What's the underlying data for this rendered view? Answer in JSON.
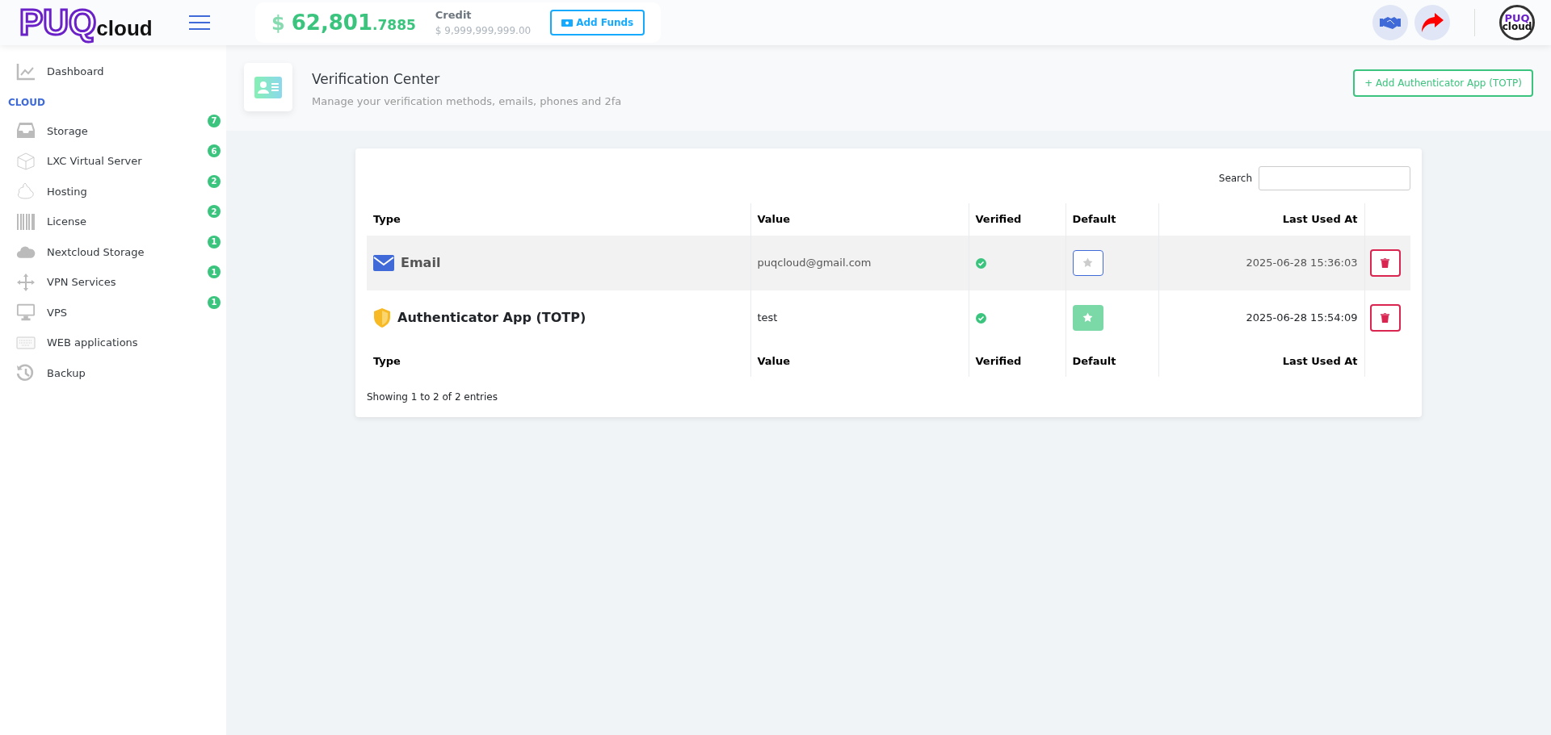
{
  "header": {
    "logo_main": "PUQ",
    "logo_sub": "cloud",
    "balance_currency": "$",
    "balance_whole": "62,801",
    "balance_fraction": ".7885",
    "credit_label": "Credit",
    "credit_value": "$ 9,999,999,999.00",
    "add_funds": "Add Funds",
    "avatar_top": "PUQ",
    "avatar_bottom": "cloud"
  },
  "sidebar": {
    "items": [
      {
        "kind": "link",
        "label": "Dashboard"
      },
      {
        "kind": "section",
        "label": "CLOUD"
      },
      {
        "kind": "link",
        "label": "Storage",
        "badge": "7"
      },
      {
        "kind": "link",
        "label": "LXC Virtual Server",
        "badge": "6"
      },
      {
        "kind": "link",
        "label": "Hosting",
        "badge": "2"
      },
      {
        "kind": "link",
        "label": "License",
        "badge": "2"
      },
      {
        "kind": "link",
        "label": "Nextcloud Storage",
        "badge": "1"
      },
      {
        "kind": "link",
        "label": "VPN Services",
        "badge": "1"
      },
      {
        "kind": "link",
        "label": "VPS",
        "badge": "1"
      },
      {
        "kind": "link",
        "label": "WEB applications"
      },
      {
        "kind": "link",
        "label": "Backup"
      }
    ]
  },
  "page": {
    "title": "Verification Center",
    "subtitle": "Manage your verification methods, emails, phones and 2fa",
    "action": "+ Add Authenticator App (TOTP)"
  },
  "table": {
    "search_label": "Search",
    "columns": [
      "Type",
      "Value",
      "Verified",
      "Default",
      "Last Used At"
    ],
    "rows": [
      {
        "kind": "email",
        "type": "Email",
        "value": "puqcloud@gmail.com",
        "verified": true,
        "default": false,
        "last_used": "2025-06-28 15:36:03",
        "highlighted": true
      },
      {
        "kind": "totp",
        "type": "Authenticator App (TOTP)",
        "value": "test",
        "verified": true,
        "default": true,
        "last_used": "2025-06-28 15:54:09",
        "highlighted": false
      }
    ],
    "footer_columns": [
      "Type",
      "Value",
      "Verified",
      "Default",
      "Last Used At"
    ],
    "info": "Showing 1 to 2 of 2 entries"
  }
}
